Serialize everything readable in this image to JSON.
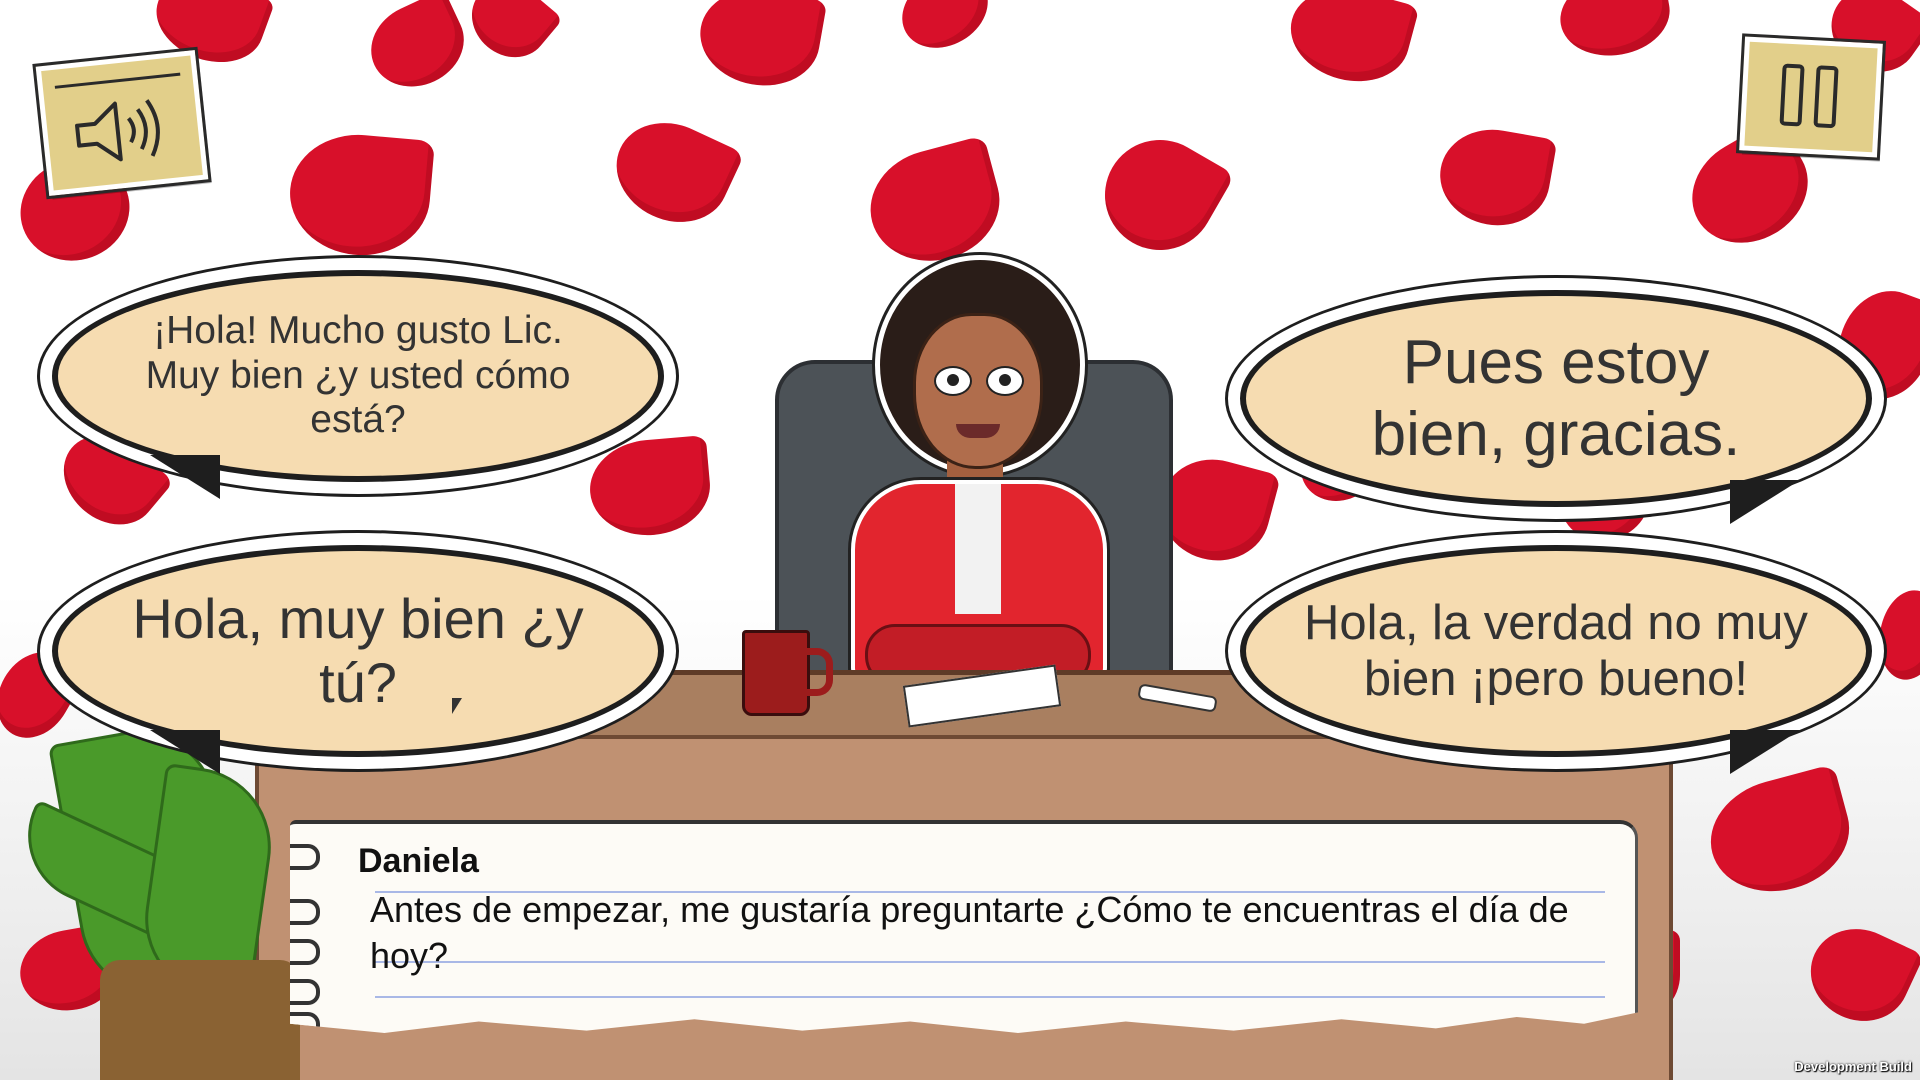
{
  "colors": {
    "petal": "#d8102a",
    "bubble_fill": "#f6dcb1",
    "note_button": "#e2cf8a",
    "jacket": "#e2252e"
  },
  "top_bar": {
    "sound_icon": "speaker-icon",
    "pause_icon": "pause-icon"
  },
  "character": {
    "name": "Daniela"
  },
  "choices": [
    {
      "text": "¡Hola! Mucho gusto Lic. Muy bien ¿y usted cómo está?"
    },
    {
      "text": "Pues estoy bien, gracias."
    },
    {
      "text": "Hola, muy bien ¿y tú?"
    },
    {
      "text": "Hola, la verdad no muy bien ¡pero bueno!"
    }
  ],
  "dialogue": {
    "speaker": "Daniela",
    "text": "Antes de empezar, me gustaría preguntarte ¿Cómo te encuentras el día de hoy?"
  },
  "footer": {
    "build_label": "Development Build"
  }
}
